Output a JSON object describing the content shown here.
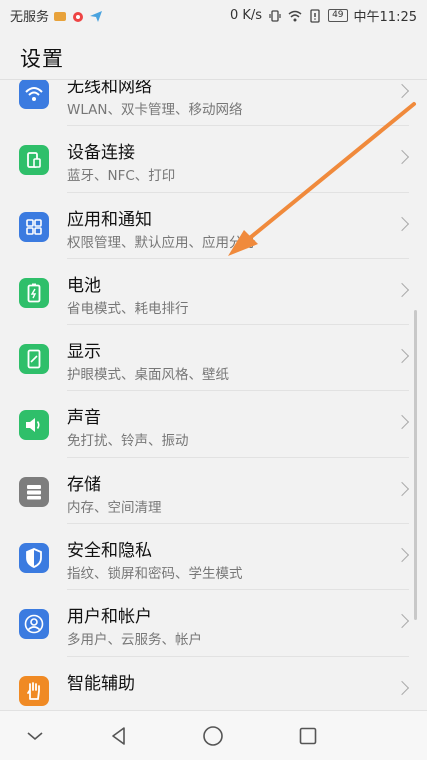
{
  "status_bar": {
    "carrier": "无服务",
    "net_speed": "0 K/s",
    "battery": "49",
    "time": "中午11:25"
  },
  "header": {
    "title": "设置"
  },
  "items": [
    {
      "title": "无线和网络",
      "subtitle": "WLAN、双卡管理、移动网络",
      "icon": "wifi-icon",
      "color": "#3b7be0"
    },
    {
      "title": "设备连接",
      "subtitle": "蓝牙、NFC、打印",
      "icon": "device-connect-icon",
      "color": "#2fbf6a"
    },
    {
      "title": "应用和通知",
      "subtitle": "权限管理、默认应用、应用分身",
      "icon": "apps-icon",
      "color": "#3b7be0"
    },
    {
      "title": "电池",
      "subtitle": "省电模式、耗电排行",
      "icon": "battery-icon",
      "color": "#2fbf6a"
    },
    {
      "title": "显示",
      "subtitle": "护眼模式、桌面风格、壁纸",
      "icon": "display-icon",
      "color": "#2fbf6a"
    },
    {
      "title": "声音",
      "subtitle": "免打扰、铃声、振动",
      "icon": "sound-icon",
      "color": "#2fbf6a"
    },
    {
      "title": "存储",
      "subtitle": "内存、空间清理",
      "icon": "storage-icon",
      "color": "#7d7d7d"
    },
    {
      "title": "安全和隐私",
      "subtitle": "指纹、锁屏和密码、学生模式",
      "icon": "shield-icon",
      "color": "#3b7be0"
    },
    {
      "title": "用户和帐户",
      "subtitle": "多用户、云服务、帐户",
      "icon": "user-icon",
      "color": "#3b7be0"
    },
    {
      "title": "智能辅助",
      "subtitle": "",
      "icon": "hand-icon",
      "color": "#f08a24"
    }
  ],
  "annotation_color": "#f08a3c",
  "nav": {
    "back_icon": "back-triangle-icon",
    "home_icon": "home-circle-icon",
    "recent_icon": "recent-square-icon",
    "collapse_icon": "chevron-down-icon"
  }
}
